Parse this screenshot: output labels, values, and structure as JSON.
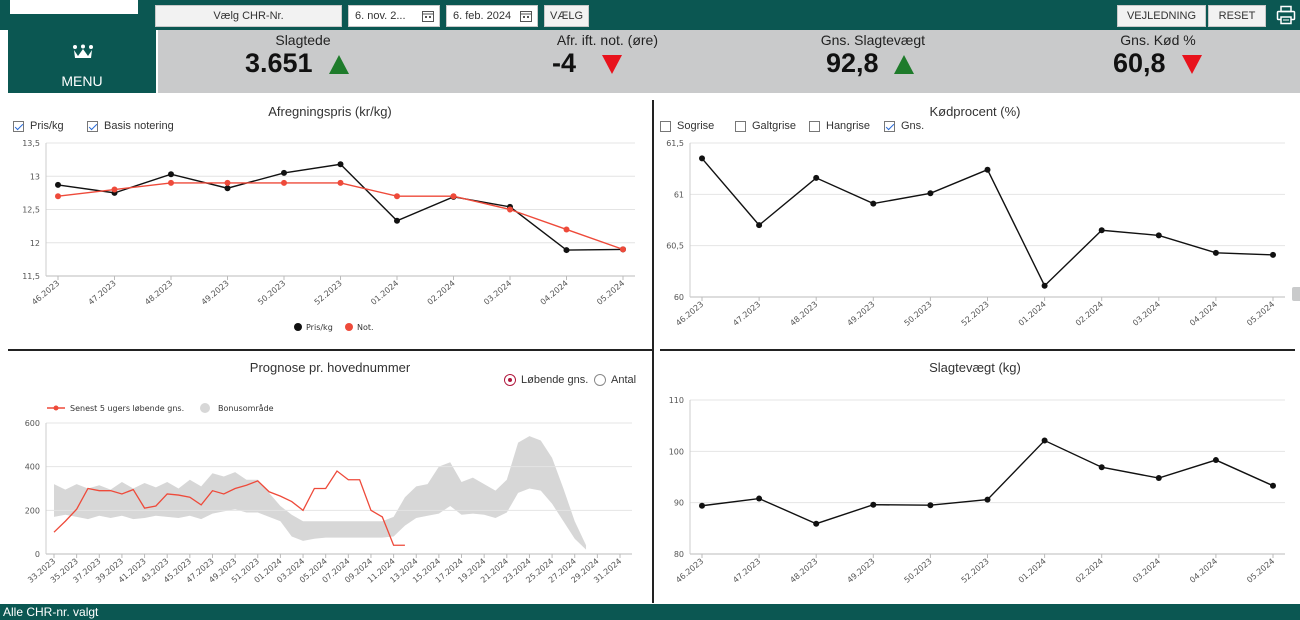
{
  "toolbar": {
    "chr_button": "Vælg CHR-Nr.",
    "date_from": "6. nov. 2...",
    "date_to": "6. feb. 2024",
    "select_button": "VÆLG",
    "guide_button": "VEJLEDNING",
    "reset_button": "RESET"
  },
  "menu": {
    "label": "MENU"
  },
  "kpis": [
    {
      "title": "Slagtede",
      "value": "3.651",
      "trend": "up"
    },
    {
      "title": "Afr. ift. not. (øre)",
      "value": "-4",
      "trend": "down"
    },
    {
      "title": "Gns. Slagtevægt",
      "value": "92,8",
      "trend": "up"
    },
    {
      "title": "Gns. Kød %",
      "value": "60,8",
      "trend": "down"
    }
  ],
  "colors": {
    "brand": "#0b5752",
    "up": "#1e7b2b",
    "down": "#e8121c",
    "series_red": "#ee4a3a",
    "band": "#d7d7d7"
  },
  "price_panel": {
    "title": "Afregningspris (kr/kg)",
    "checkboxes": [
      {
        "label": "Pris/kg",
        "checked": true
      },
      {
        "label": "Basis notering",
        "checked": true
      }
    ]
  },
  "meat_panel": {
    "title": "Kødprocent (%)",
    "checkboxes": [
      {
        "label": "Sogrise",
        "checked": false
      },
      {
        "label": "Galtgrise",
        "checked": false
      },
      {
        "label": "Hangrise",
        "checked": false
      },
      {
        "label": "Gns.",
        "checked": true
      }
    ]
  },
  "forecast_panel": {
    "title": "Prognose pr. hovednummer",
    "radios": [
      {
        "label": "Løbende gns.",
        "selected": true
      },
      {
        "label": "Antal",
        "selected": false
      }
    ]
  },
  "weight_panel": {
    "title": "Slagtevægt (kg)"
  },
  "footer": {
    "status": "Alle CHR-nr. valgt"
  },
  "chart_data": [
    {
      "type": "line",
      "title": "Afregningspris (kr/kg)",
      "x": [
        "46.2023",
        "47.2023",
        "48.2023",
        "49.2023",
        "50.2023",
        "52.2023",
        "01.2024",
        "02.2024",
        "03.2024",
        "04.2024",
        "05.2024"
      ],
      "yticks": [
        "13,5",
        "13",
        "12,5",
        "12",
        "11,5"
      ],
      "ylim": [
        11.5,
        13.5
      ],
      "grid": true,
      "legend_position": "bottom",
      "series": [
        {
          "name": "Pris/kg",
          "color": "#111111",
          "values": [
            12.87,
            12.75,
            13.03,
            12.82,
            13.05,
            13.18,
            12.33,
            12.69,
            12.54,
            11.89,
            11.9
          ]
        },
        {
          "name": "Not.",
          "color": "#ee4a3a",
          "values": [
            12.7,
            12.8,
            12.9,
            12.9,
            12.9,
            12.9,
            12.7,
            12.7,
            12.5,
            12.2,
            11.9
          ]
        }
      ]
    },
    {
      "type": "line",
      "title": "Kødprocent (%)",
      "x": [
        "46.2023",
        "47.2023",
        "48.2023",
        "49.2023",
        "50.2023",
        "52.2023",
        "01.2024",
        "02.2024",
        "03.2024",
        "04.2024",
        "05.2024"
      ],
      "yticks": [
        "61,5",
        "61",
        "60,5",
        "60"
      ],
      "ylim": [
        60,
        61.5
      ],
      "grid": true,
      "series": [
        {
          "name": "Gns.",
          "color": "#111111",
          "values": [
            61.35,
            60.7,
            61.16,
            60.91,
            61.01,
            61.24,
            60.11,
            60.65,
            60.6,
            60.43,
            60.41
          ]
        }
      ]
    },
    {
      "type": "area",
      "title": "Prognose pr. hovednummer",
      "x": [
        "33.2023",
        "34.2023",
        "35.2023",
        "36.2023",
        "37.2023",
        "38.2023",
        "39.2023",
        "40.2023",
        "41.2023",
        "42.2023",
        "43.2023",
        "44.2023",
        "45.2023",
        "46.2023",
        "47.2023",
        "48.2023",
        "49.2023",
        "50.2023",
        "51.2023",
        "52.2023",
        "01.2024",
        "02.2024",
        "03.2024",
        "04.2024",
        "05.2024",
        "06.2024",
        "07.2024",
        "08.2024",
        "09.2024",
        "10.2024",
        "11.2024",
        "12.2024",
        "13.2024",
        "14.2024",
        "15.2024",
        "16.2024",
        "17.2024",
        "18.2024",
        "19.2024",
        "20.2024",
        "21.2024",
        "22.2024",
        "23.2024",
        "24.2024",
        "25.2024",
        "26.2024",
        "27.2024",
        "28.2024",
        "29.2024",
        "30.2024",
        "31.2024"
      ],
      "xtick_labels": [
        "33.2023",
        "35.2023",
        "37.2023",
        "39.2023",
        "41.2023",
        "43.2023",
        "45.2023",
        "47.2023",
        "49.2023",
        "51.2023",
        "01.2024",
        "03.2024",
        "05.2024",
        "07.2024",
        "09.2024",
        "11.2024",
        "13.2024",
        "15.2024",
        "17.2024",
        "19.2024",
        "21.2024",
        "23.2024",
        "25.2024",
        "27.2024",
        "29.2024",
        "31.2024"
      ],
      "yticks": [
        "600",
        "400",
        "200",
        "0"
      ],
      "ylim": [
        0,
        600
      ],
      "grid": true,
      "legend_position": "top-left",
      "series": [
        {
          "name": "Senest 5 ugers løbende gns.",
          "color": "#ee4a3a",
          "values": [
            100,
            150,
            205,
            300,
            290,
            290,
            275,
            295,
            210,
            220,
            275,
            270,
            260,
            225,
            290,
            275,
            300,
            315,
            335,
            285,
            265,
            240,
            200,
            300,
            300,
            380,
            340,
            340,
            200,
            170,
            40,
            40
          ]
        },
        {
          "name": "Bonusområde",
          "color": "#d7d7d7",
          "upper": [
            320,
            295,
            320,
            300,
            315,
            295,
            330,
            300,
            325,
            305,
            330,
            300,
            340,
            310,
            370,
            355,
            375,
            340,
            340,
            280,
            220,
            180,
            150,
            150,
            150,
            150,
            150,
            150,
            150,
            150,
            170,
            260,
            310,
            320,
            400,
            420,
            330,
            350,
            320,
            290,
            340,
            510,
            540,
            520,
            440,
            300,
            150,
            40
          ],
          "lower": [
            170,
            180,
            170,
            160,
            175,
            165,
            175,
            160,
            165,
            175,
            170,
            165,
            175,
            160,
            185,
            195,
            205,
            190,
            190,
            170,
            150,
            80,
            60,
            70,
            75,
            75,
            75,
            75,
            75,
            75,
            80,
            130,
            165,
            175,
            185,
            220,
            180,
            185,
            180,
            165,
            190,
            280,
            300,
            290,
            230,
            150,
            70,
            20
          ]
        }
      ]
    },
    {
      "type": "line",
      "title": "Slagtevægt (kg)",
      "x": [
        "46.2023",
        "47.2023",
        "48.2023",
        "49.2023",
        "50.2023",
        "52.2023",
        "01.2024",
        "02.2024",
        "03.2024",
        "04.2024",
        "05.2024"
      ],
      "yticks": [
        "110",
        "100",
        "90",
        "80"
      ],
      "ylim": [
        80,
        110
      ],
      "grid": true,
      "series": [
        {
          "name": "Slagtevægt",
          "color": "#111111",
          "values": [
            89.4,
            90.8,
            85.9,
            89.6,
            89.5,
            90.6,
            102.1,
            96.9,
            94.8,
            98.3,
            93.3
          ]
        }
      ]
    }
  ]
}
